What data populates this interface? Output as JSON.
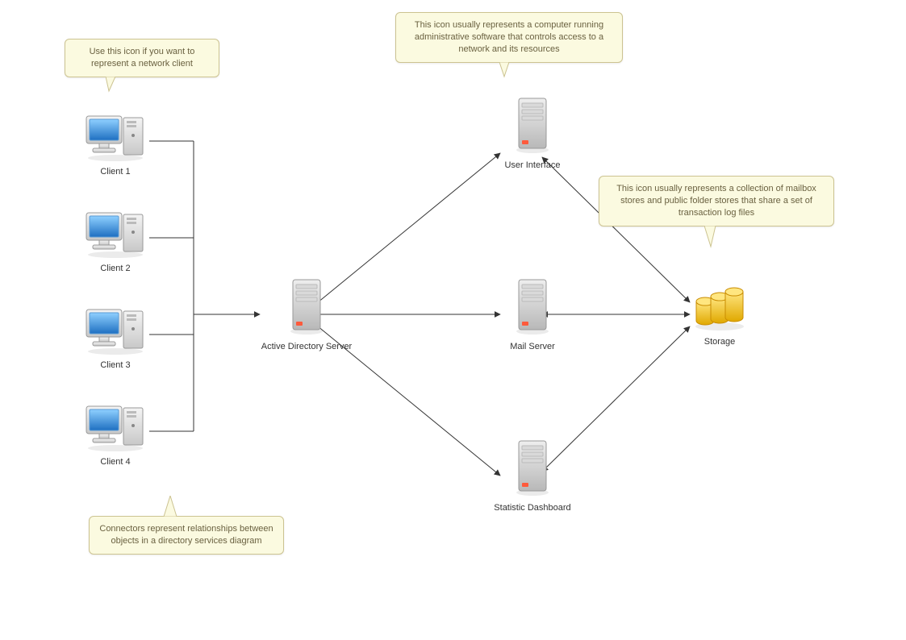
{
  "nodes": {
    "client1": {
      "label": "Client 1"
    },
    "client2": {
      "label": "Client 2"
    },
    "client3": {
      "label": "Client 3"
    },
    "client4": {
      "label": "Client 4"
    },
    "ads": {
      "label": "Active Directory Server"
    },
    "ui": {
      "label": "User Interface"
    },
    "mail": {
      "label": "Mail Server"
    },
    "stats": {
      "label": "Statistic Dashboard"
    },
    "storage": {
      "label": "Storage"
    }
  },
  "callouts": {
    "client": "Use this icon if you want to represent a network client",
    "ui": "This icon usually represents a computer running administrative software that controls access to a network and its resources",
    "storage": "This icon usually represents a collection of mailbox stores and public folder stores that share a set of transaction log files",
    "connector": "Connectors represent relationships between objects in a directory services diagram"
  }
}
